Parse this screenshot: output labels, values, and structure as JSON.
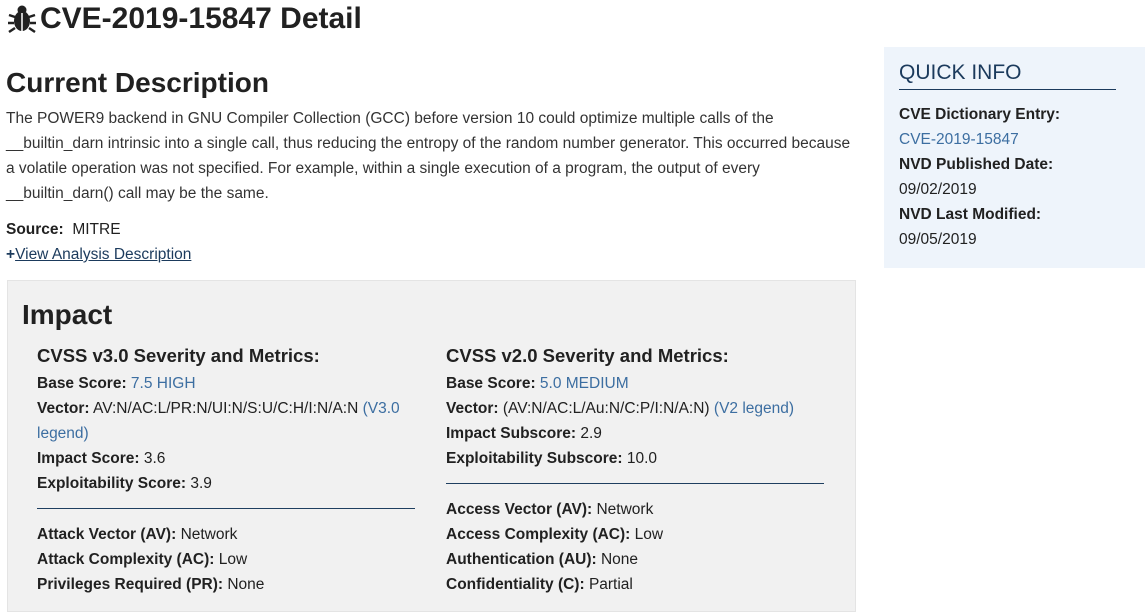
{
  "header": {
    "title": "CVE-2019-15847 Detail"
  },
  "description": {
    "heading": "Current Description",
    "text": "The POWER9 backend in GNU Compiler Collection (GCC) before version 10 could optimize multiple calls of the __builtin_darn intrinsic into a single call, thus reducing the entropy of the random number generator. This occurred because a volatile operation was not specified. For example, within a single execution of a program, the output of every __builtin_darn() call may be the same.",
    "source_label": "Source:",
    "source_value": "MITRE",
    "view_analysis_plus": "+",
    "view_analysis_label": "View Analysis Description"
  },
  "impact": {
    "heading": "Impact",
    "v3": {
      "title": "CVSS v3.0 Severity and Metrics:",
      "base_score_label": "Base Score:",
      "base_score_value": "7.5 HIGH",
      "vector_label": "Vector:",
      "vector_value": "AV:N/AC:L/PR:N/UI:N/S:U/C:H/I:N/A:N",
      "legend_open": "(",
      "legend_link": "V3.0 legend",
      "legend_close": ")",
      "impact_label": "Impact Score:",
      "impact_value": "3.6",
      "exploitability_label": "Exploitability Score:",
      "exploitability_value": "3.9",
      "metrics": [
        {
          "label": "Attack Vector (AV):",
          "value": "Network"
        },
        {
          "label": "Attack Complexity (AC):",
          "value": "Low"
        },
        {
          "label": "Privileges Required (PR):",
          "value": "None"
        }
      ]
    },
    "v2": {
      "title": "CVSS v2.0 Severity and Metrics:",
      "base_score_label": "Base Score:",
      "base_score_value": "5.0 MEDIUM",
      "vector_label": "Vector:",
      "vector_value": "(AV:N/AC:L/Au:N/C:P/I:N/A:N)",
      "legend_open": "(",
      "legend_link": "V2 legend",
      "legend_close": ")",
      "impact_label": "Impact Subscore:",
      "impact_value": "2.9",
      "exploitability_label": "Exploitability Subscore:",
      "exploitability_value": "10.0",
      "metrics": [
        {
          "label": "Access Vector (AV):",
          "value": "Network"
        },
        {
          "label": "Access Complexity (AC):",
          "value": "Low"
        },
        {
          "label": "Authentication (AU):",
          "value": "None"
        },
        {
          "label": "Confidentiality (C):",
          "value": "Partial"
        }
      ]
    }
  },
  "quick_info": {
    "heading": "QUICK INFO",
    "dictionary_label": "CVE Dictionary Entry:",
    "dictionary_value": "CVE-2019-15847",
    "published_label": "NVD Published Date:",
    "published_value": "09/02/2019",
    "modified_label": "NVD Last Modified:",
    "modified_value": "09/05/2019"
  },
  "colors": {
    "link": "#3c6ea1",
    "dark_link": "#1b3a5c",
    "impact_bg": "#f1f1f1",
    "quick_info_bg": "#eef4fb"
  },
  "icons": {
    "title_icon": "bug-icon"
  }
}
